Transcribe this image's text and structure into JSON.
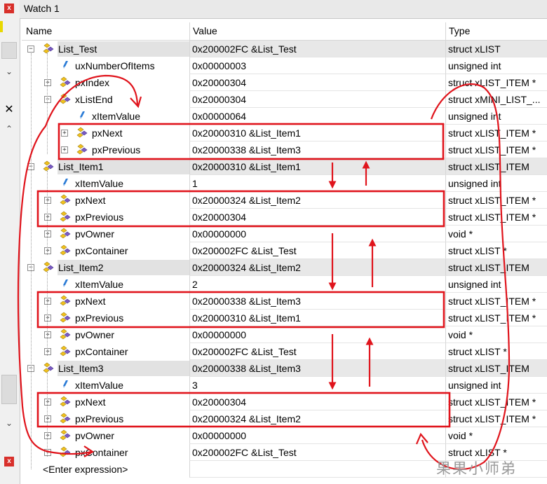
{
  "window": {
    "title": "Watch 1",
    "close_label": "x"
  },
  "columns": {
    "name": "Name",
    "value": "Value",
    "type": "Type"
  },
  "rows": [
    {
      "name": "List_Test",
      "value": "0x200002FC &List_Test",
      "type": "struct xLIST",
      "level": 0,
      "expander": "minus",
      "icon": "struct",
      "root": true
    },
    {
      "name": "uxNumberOfItems",
      "value": "0x00000003",
      "type": "unsigned int",
      "level": 1,
      "expander": "none",
      "icon": "var"
    },
    {
      "name": "pxIndex",
      "value": "0x20000304",
      "type": "struct xLIST_ITEM *",
      "level": 1,
      "expander": "plus",
      "icon": "struct"
    },
    {
      "name": "xListEnd",
      "value": "0x20000304",
      "type": "struct xMINI_LIST_...",
      "level": 1,
      "expander": "minus",
      "icon": "struct"
    },
    {
      "name": "xItemValue",
      "value": "0x00000064",
      "type": "unsigned int",
      "level": 2,
      "expander": "none",
      "icon": "var"
    },
    {
      "name": "pxNext",
      "value": "0x20000310 &List_Item1",
      "type": "struct xLIST_ITEM *",
      "level": 2,
      "expander": "plus",
      "icon": "struct"
    },
    {
      "name": "pxPrevious",
      "value": "0x20000338 &List_Item3",
      "type": "struct xLIST_ITEM *",
      "level": 2,
      "expander": "plus",
      "icon": "struct"
    },
    {
      "name": "List_Item1",
      "value": "0x20000310 &List_Item1",
      "type": "struct xLIST_ITEM",
      "level": 0,
      "expander": "minus",
      "icon": "struct",
      "root": true
    },
    {
      "name": "xItemValue",
      "value": "1",
      "type": "unsigned int",
      "level": 1,
      "expander": "none",
      "icon": "var"
    },
    {
      "name": "pxNext",
      "value": "0x20000324 &List_Item2",
      "type": "struct xLIST_ITEM *",
      "level": 1,
      "expander": "plus",
      "icon": "struct"
    },
    {
      "name": "pxPrevious",
      "value": "0x20000304",
      "type": "struct xLIST_ITEM *",
      "level": 1,
      "expander": "plus",
      "icon": "struct"
    },
    {
      "name": "pvOwner",
      "value": "0x00000000",
      "type": "void *",
      "level": 1,
      "expander": "plus",
      "icon": "struct"
    },
    {
      "name": "pxContainer",
      "value": "0x200002FC &List_Test",
      "type": "struct xLIST *",
      "level": 1,
      "expander": "plus",
      "icon": "struct"
    },
    {
      "name": "List_Item2",
      "value": "0x20000324 &List_Item2",
      "type": "struct xLIST_ITEM",
      "level": 0,
      "expander": "minus",
      "icon": "struct",
      "root": true
    },
    {
      "name": "xItemValue",
      "value": "2",
      "type": "unsigned int",
      "level": 1,
      "expander": "none",
      "icon": "var"
    },
    {
      "name": "pxNext",
      "value": "0x20000338 &List_Item3",
      "type": "struct xLIST_ITEM *",
      "level": 1,
      "expander": "plus",
      "icon": "struct"
    },
    {
      "name": "pxPrevious",
      "value": "0x20000310 &List_Item1",
      "type": "struct xLIST_ITEM *",
      "level": 1,
      "expander": "plus",
      "icon": "struct"
    },
    {
      "name": "pvOwner",
      "value": "0x00000000",
      "type": "void *",
      "level": 1,
      "expander": "plus",
      "icon": "struct"
    },
    {
      "name": "pxContainer",
      "value": "0x200002FC &List_Test",
      "type": "struct xLIST *",
      "level": 1,
      "expander": "plus",
      "icon": "struct"
    },
    {
      "name": "List_Item3",
      "value": "0x20000338 &List_Item3",
      "type": "struct xLIST_ITEM",
      "level": 0,
      "expander": "minus",
      "icon": "struct",
      "root": true
    },
    {
      "name": "xItemValue",
      "value": "3",
      "type": "unsigned int",
      "level": 1,
      "expander": "none",
      "icon": "var"
    },
    {
      "name": "pxNext",
      "value": "0x20000304",
      "type": "struct xLIST_ITEM *",
      "level": 1,
      "expander": "plus",
      "icon": "struct"
    },
    {
      "name": "pxPrevious",
      "value": "0x20000324 &List_Item2",
      "type": "struct xLIST_ITEM *",
      "level": 1,
      "expander": "plus",
      "icon": "struct"
    },
    {
      "name": "pvOwner",
      "value": "0x00000000",
      "type": "void *",
      "level": 1,
      "expander": "plus",
      "icon": "struct"
    },
    {
      "name": "pxContainer",
      "value": "0x200002FC &List_Test",
      "type": "struct xLIST *",
      "level": 1,
      "expander": "plus",
      "icon": "struct"
    }
  ],
  "enter_expression": "<Enter expression>",
  "watermark": "果果小师弟",
  "colors": {
    "annotation": "#e0141c",
    "struct_icon_yellow": "#f2c21b",
    "struct_icon_purple": "#7b5bc4",
    "var_icon_blue": "#2a7bd6",
    "root_row_bg": "#e8e8e8"
  }
}
